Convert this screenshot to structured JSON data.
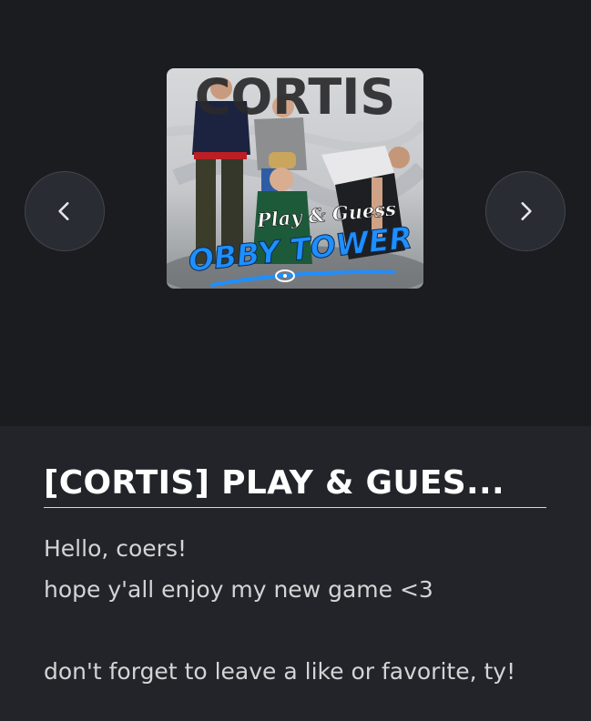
{
  "carousel": {
    "prev_icon": "chevron-left-icon",
    "next_icon": "chevron-right-icon",
    "thumbnail": {
      "brand_text": "CORTIS",
      "subtitle_text": "Play & Guess",
      "main_text": "OBBY TOWER",
      "accent_color": "#1e8fff"
    }
  },
  "game": {
    "title": "[CORTIS] PLAY & GUES...",
    "description_lines": [
      "Hello, coers!",
      "hope y'all enjoy my new game <3",
      "",
      "don't forget to leave a like or favorite, ty!"
    ]
  },
  "colors": {
    "background": "#1b1c20",
    "panel": "#232429",
    "title_text": "#ffffff",
    "body_text": "#d3d4d6"
  }
}
